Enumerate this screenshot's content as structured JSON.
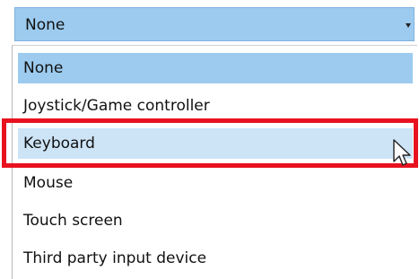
{
  "combo": {
    "selected_value": "None",
    "arrow_icon": "caret-down-icon"
  },
  "dropdown": {
    "options": [
      {
        "label": "None",
        "state": "selected"
      },
      {
        "label": "Joystick/Game controller",
        "state": "normal"
      },
      {
        "label": "Keyboard",
        "state": "hovered"
      },
      {
        "label": "Mouse",
        "state": "normal"
      },
      {
        "label": "Touch screen",
        "state": "normal"
      },
      {
        "label": "Third party input device",
        "state": "normal"
      }
    ]
  },
  "annotation": {
    "highlight_color": "#e8121f",
    "highlighted_option": "Keyboard"
  },
  "colors": {
    "selected_bg": "#9ccbef",
    "hover_bg": "#cde4f7"
  },
  "cursor": {
    "icon": "arrow-pointer-icon"
  }
}
